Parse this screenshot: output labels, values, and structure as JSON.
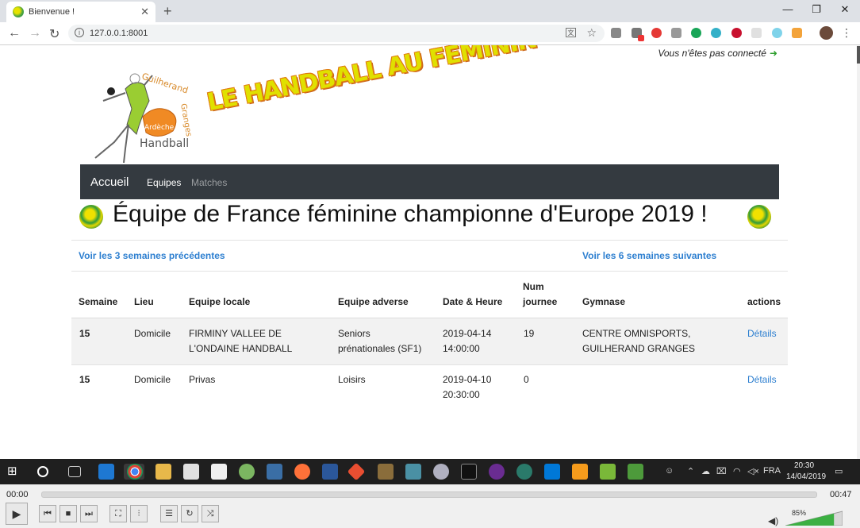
{
  "browser": {
    "tab_title": "Bienvenue !",
    "url": "127.0.0.1:8001"
  },
  "page": {
    "login_status": "Vous n'êtes pas connecté",
    "banner": "LE HANDBALL AU FÉMININ",
    "logo_texts": [
      "Guilherand",
      "Granges",
      "Ardèche",
      "Handball"
    ],
    "nav": {
      "brand": "Accueil",
      "equipes": "Equipes",
      "matches": "Matches"
    },
    "headline": "Équipe de France féminine championne d'Europe 2019 !",
    "prev_link": "Voir les 3 semaines précédentes",
    "next_link": "Voir les 6 semaines suivantes",
    "table": {
      "headers": {
        "semaine": "Semaine",
        "lieu": "Lieu",
        "locale": "Equipe locale",
        "adverse": "Equipe adverse",
        "date": "Date & Heure",
        "num1": "Num",
        "num2": "journee",
        "gymnase": "Gymnase",
        "actions": "actions"
      },
      "rows": [
        {
          "semaine": "15",
          "lieu": "Domicile",
          "locale1": "FIRMINY VALLEE DE",
          "locale2": "L'ONDAINE HANDBALL",
          "adverse1": "Seniors",
          "adverse2": "prénationales (SF1)",
          "date1": "2019-04-14",
          "date2": "14:00:00",
          "journee": "19",
          "gymnase1": "CENTRE OMNISPORTS,",
          "gymnase2": "GUILHERAND GRANGES",
          "action": "Détails"
        },
        {
          "semaine": "15",
          "lieu": "Domicile",
          "locale1": "Privas",
          "locale2": "",
          "adverse1": "Loisirs",
          "adverse2": "",
          "date1": "2019-04-10",
          "date2": "20:30:00",
          "journee": "0",
          "gymnase1": "",
          "gymnase2": "",
          "action": "Détails"
        }
      ]
    }
  },
  "taskbar": {
    "language": "FRA",
    "time": "20:30",
    "date": "14/04/2019"
  },
  "player": {
    "time_current": "00:00",
    "time_total": "00:47",
    "volume": "85%",
    "volume_level": 0.85,
    "progress": 0
  },
  "colors": {
    "link": "#2d7fd0",
    "navbar": "#343a40",
    "banner_fill": "#e0e000",
    "banner_outline": "#e07b10"
  }
}
